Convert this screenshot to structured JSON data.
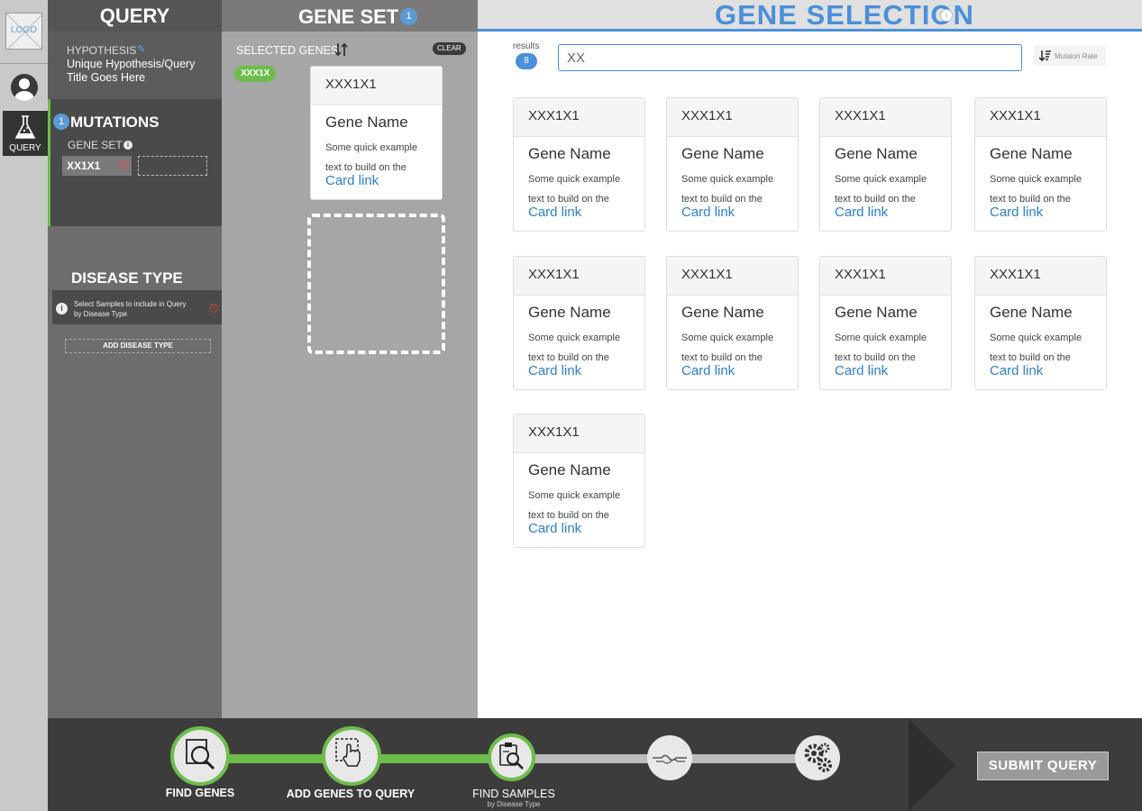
{
  "logo": "LOGO",
  "rail": {
    "query_label": "QUERY"
  },
  "query_panel": {
    "title": "QUERY",
    "hypothesis_label": "HYPOTHESIS",
    "hypothesis_title": "Unique Hypothesis/Query Title Goes Here",
    "mutations": {
      "count": "1",
      "title": "MUTATIONS",
      "gene_set_label": "GENE SET",
      "gene_chip": "XX1X1"
    },
    "disease_type": {
      "title": "DISEASE TYPE",
      "hint": "Select Samples to include in Query by Disease Type",
      "add_button": "ADD DISEASE TYPE"
    }
  },
  "gene_set_panel": {
    "title": "GENE SET",
    "count": "1",
    "selected_label": "SELECTED GENES",
    "clear_label": "CLEAR",
    "selected_chip": "XXX1X",
    "preview_card": {
      "header": "XXX1X1",
      "title": "Gene Name",
      "text": "Some quick example text to build on the",
      "link": "Card link"
    }
  },
  "gene_selection": {
    "title": "GENE SELECTION",
    "results_label": "results",
    "results_count": "8",
    "search_value": "XX",
    "sort_label": "Mutaion Rate",
    "cards": [
      {
        "header": "XXX1X1",
        "title": "Gene Name",
        "text": "Some quick example text to build on the",
        "link": "Card link"
      },
      {
        "header": "XXX1X1",
        "title": "Gene Name",
        "text": "Some quick example text to build on the",
        "link": "Card link"
      },
      {
        "header": "XXX1X1",
        "title": "Gene Name",
        "text": "Some quick example text to build on the",
        "link": "Card link"
      },
      {
        "header": "XXX1X1",
        "title": "Gene Name",
        "text": "Some quick example text to build on the",
        "link": "Card link"
      },
      {
        "header": "XXX1X1",
        "title": "Gene Name",
        "text": "Some quick example text to build on the",
        "link": "Card link"
      },
      {
        "header": "XXX1X1",
        "title": "Gene Name",
        "text": "Some quick example text to build on the",
        "link": "Card link"
      },
      {
        "header": "XXX1X1",
        "title": "Gene Name",
        "text": "Some quick example text to build on the",
        "link": "Card link"
      },
      {
        "header": "XXX1X1",
        "title": "Gene Name",
        "text": "Some quick example text to build on the",
        "link": "Card link"
      },
      {
        "header": "XXX1X1",
        "title": "Gene Name",
        "text": "Some quick example text to build on the",
        "link": "Card link"
      }
    ]
  },
  "wizard": {
    "steps": [
      {
        "label": "FIND GENES",
        "icon": "find-genes-icon",
        "status": "complete"
      },
      {
        "label": "ADD GENES TO QUERY",
        "icon": "add-genes-icon",
        "status": "complete"
      },
      {
        "label": "FIND SAMPLES",
        "sublabel": "by Disease Type",
        "icon": "find-samples-icon",
        "status": "current"
      },
      {
        "icon": "pipeline-icon",
        "status": "pending"
      },
      {
        "icon": "gears-icon",
        "status": "pending"
      }
    ],
    "submit_label": "SUBMIT QUERY"
  },
  "colors": {
    "accent_blue": "#4a90d9",
    "accent_green": "#6ebd4c",
    "link_blue": "#2f7fc8"
  }
}
